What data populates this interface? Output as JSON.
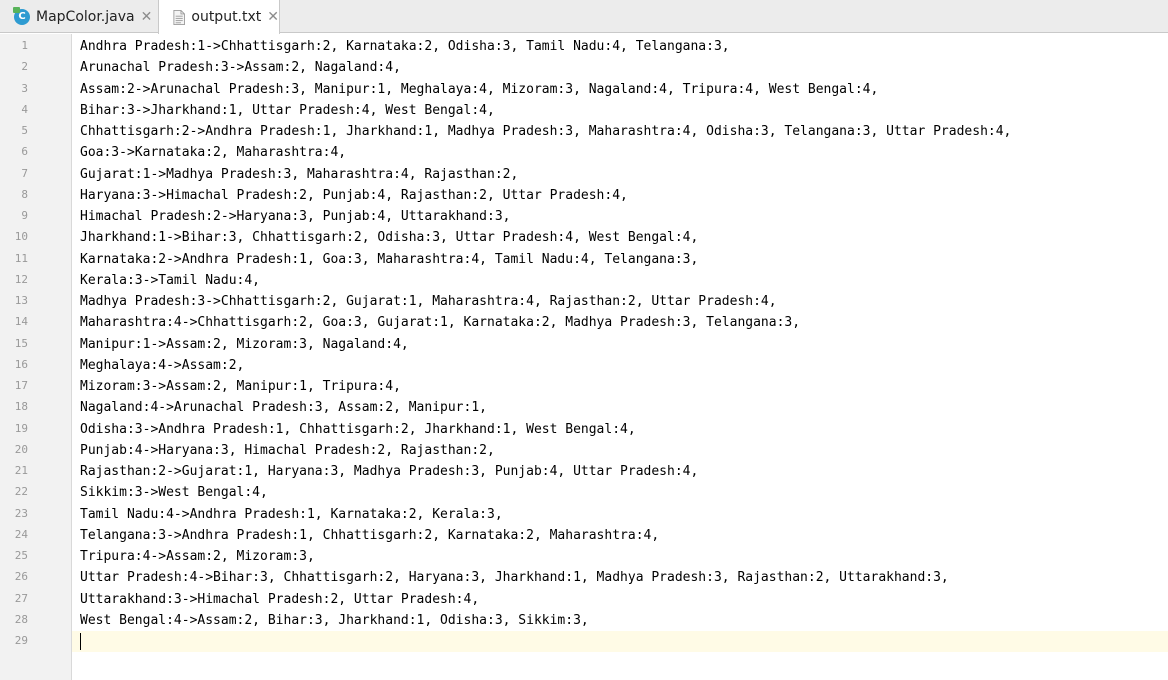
{
  "tabs": [
    {
      "label": "MapColor.java",
      "icon": "java-class-icon",
      "active": false
    },
    {
      "label": "output.txt",
      "icon": "text-file-icon",
      "active": true
    }
  ],
  "editor": {
    "current_line": 29,
    "lines": [
      "Andhra Pradesh:1->Chhattisgarh:2, Karnataka:2, Odisha:3, Tamil Nadu:4, Telangana:3,",
      "Arunachal Pradesh:3->Assam:2, Nagaland:4,",
      "Assam:2->Arunachal Pradesh:3, Manipur:1, Meghalaya:4, Mizoram:3, Nagaland:4, Tripura:4, West Bengal:4,",
      "Bihar:3->Jharkhand:1, Uttar Pradesh:4, West Bengal:4,",
      "Chhattisgarh:2->Andhra Pradesh:1, Jharkhand:1, Madhya Pradesh:3, Maharashtra:4, Odisha:3, Telangana:3, Uttar Pradesh:4,",
      "Goa:3->Karnataka:2, Maharashtra:4,",
      "Gujarat:1->Madhya Pradesh:3, Maharashtra:4, Rajasthan:2,",
      "Haryana:3->Himachal Pradesh:2, Punjab:4, Rajasthan:2, Uttar Pradesh:4,",
      "Himachal Pradesh:2->Haryana:3, Punjab:4, Uttarakhand:3,",
      "Jharkhand:1->Bihar:3, Chhattisgarh:2, Odisha:3, Uttar Pradesh:4, West Bengal:4,",
      "Karnataka:2->Andhra Pradesh:1, Goa:3, Maharashtra:4, Tamil Nadu:4, Telangana:3,",
      "Kerala:3->Tamil Nadu:4,",
      "Madhya Pradesh:3->Chhattisgarh:2, Gujarat:1, Maharashtra:4, Rajasthan:2, Uttar Pradesh:4,",
      "Maharashtra:4->Chhattisgarh:2, Goa:3, Gujarat:1, Karnataka:2, Madhya Pradesh:3, Telangana:3,",
      "Manipur:1->Assam:2, Mizoram:3, Nagaland:4,",
      "Meghalaya:4->Assam:2,",
      "Mizoram:3->Assam:2, Manipur:1, Tripura:4,",
      "Nagaland:4->Arunachal Pradesh:3, Assam:2, Manipur:1,",
      "Odisha:3->Andhra Pradesh:1, Chhattisgarh:2, Jharkhand:1, West Bengal:4,",
      "Punjab:4->Haryana:3, Himachal Pradesh:2, Rajasthan:2,",
      "Rajasthan:2->Gujarat:1, Haryana:3, Madhya Pradesh:3, Punjab:4, Uttar Pradesh:4,",
      "Sikkim:3->West Bengal:4,",
      "Tamil Nadu:4->Andhra Pradesh:1, Karnataka:2, Kerala:3,",
      "Telangana:3->Andhra Pradesh:1, Chhattisgarh:2, Karnataka:2, Maharashtra:4,",
      "Tripura:4->Assam:2, Mizoram:3,",
      "Uttar Pradesh:4->Bihar:3, Chhattisgarh:2, Haryana:3, Jharkhand:1, Madhya Pradesh:3, Rajasthan:2, Uttarakhand:3,",
      "Uttarakhand:3->Himachal Pradesh:2, Uttar Pradesh:4,",
      "West Bengal:4->Assam:2, Bihar:3, Jharkhand:1, Odisha:3, Sikkim:3,",
      ""
    ]
  }
}
